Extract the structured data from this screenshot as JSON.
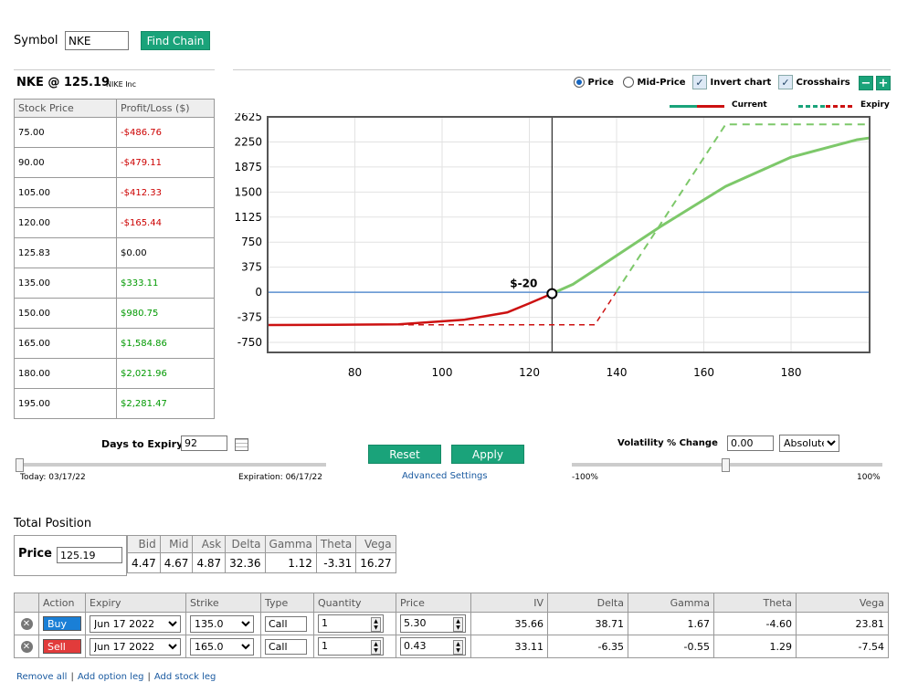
{
  "header": {
    "symbol_label": "Symbol",
    "symbol_value": "NKE",
    "find_chain": "Find Chain"
  },
  "quote": {
    "title": "NKE @ 125.19",
    "company": "NIKE Inc"
  },
  "pl_table": {
    "headers": [
      "Stock Price",
      "Profit/Loss ($)"
    ],
    "rows": [
      [
        "75.00",
        "-$486.76"
      ],
      [
        "90.00",
        "-$479.11"
      ],
      [
        "105.00",
        "-$412.33"
      ],
      [
        "120.00",
        "-$165.44"
      ],
      [
        "125.83",
        "$0.00"
      ],
      [
        "135.00",
        "$333.11"
      ],
      [
        "150.00",
        "$980.75"
      ],
      [
        "165.00",
        "$1,584.86"
      ],
      [
        "180.00",
        "$2,021.96"
      ],
      [
        "195.00",
        "$2,281.47"
      ]
    ]
  },
  "chart_controls": {
    "price": "Price",
    "mid_price": "Mid-Price",
    "invert": "Invert chart",
    "crosshairs": "Crosshairs",
    "minus": "−",
    "plus": "+",
    "legend_current": "Current",
    "legend_expiry": "Expiry"
  },
  "chart_data": {
    "type": "line",
    "y_ticks": [
      "2625",
      "2250",
      "1875",
      "1500",
      "1125",
      "750",
      "375",
      "0",
      "-375",
      "-750"
    ],
    "x_ticks": [
      "80",
      "100",
      "120",
      "140",
      "160",
      "180"
    ],
    "xlim": [
      60,
      198
    ],
    "ylim": [
      -900,
      2625
    ],
    "marker_label": "$-20",
    "marker_x": 125.19,
    "marker_y": -20,
    "series": [
      {
        "name": "Current",
        "color_neg": "#cc1111",
        "color_pos": "#7dc86a",
        "x": [
          60,
          75,
          90,
          105,
          115,
          120,
          125.19,
          130,
          135,
          150,
          165,
          180,
          195,
          198
        ],
        "y": [
          -490,
          -486.76,
          -479.11,
          -412.33,
          -300,
          -165.44,
          -20,
          120,
          333.11,
          980.75,
          1584.86,
          2021.96,
          2281.47,
          2310
        ]
      },
      {
        "name": "Expiry",
        "color_neg": "#cc1111",
        "color_pos": "#7dc86a",
        "x": [
          60,
          135,
          165,
          198
        ],
        "y": [
          -487,
          -487,
          2513,
          2513
        ]
      }
    ],
    "grid": true
  },
  "expiry_ctrl": {
    "label": "Days to Expiry",
    "value": "92",
    "today": "Today: 03/17/22",
    "expiration": "Expiration: 06/17/22"
  },
  "actions": {
    "reset": "Reset",
    "apply": "Apply",
    "advanced": "Advanced Settings"
  },
  "vol_ctrl": {
    "label": "Volatility % Change",
    "value": "0.00",
    "mode": "Absolute",
    "min": "-100%",
    "max": "100%"
  },
  "total": {
    "title": "Total Position",
    "price_label": "Price",
    "price_value": "125.19",
    "headers": [
      "Bid",
      "Mid",
      "Ask",
      "Delta",
      "Gamma",
      "Theta",
      "Vega"
    ],
    "values": [
      "4.47",
      "4.67",
      "4.87",
      "32.36",
      "1.12",
      "-3.31",
      "16.27"
    ]
  },
  "legs": {
    "headers": [
      "Action",
      "Expiry",
      "Strike",
      "Type",
      "Quantity",
      "Price",
      "IV",
      "Delta",
      "Gamma",
      "Theta",
      "Vega"
    ],
    "rows": [
      {
        "action": "Buy",
        "expiry": "Jun 17 2022",
        "strike": "135.0",
        "type": "Call",
        "qty": "1",
        "price": "5.30",
        "iv": "35.66",
        "delta": "38.71",
        "gamma": "1.67",
        "theta": "-4.60",
        "vega": "23.81"
      },
      {
        "action": "Sell",
        "expiry": "Jun 17 2022",
        "strike": "165.0",
        "type": "Call",
        "qty": "1",
        "price": "0.43",
        "iv": "33.11",
        "delta": "-6.35",
        "gamma": "-0.55",
        "theta": "1.29",
        "vega": "-7.54"
      }
    ]
  },
  "footer_links": [
    "Remove all",
    "Add option leg",
    "Add stock leg"
  ]
}
